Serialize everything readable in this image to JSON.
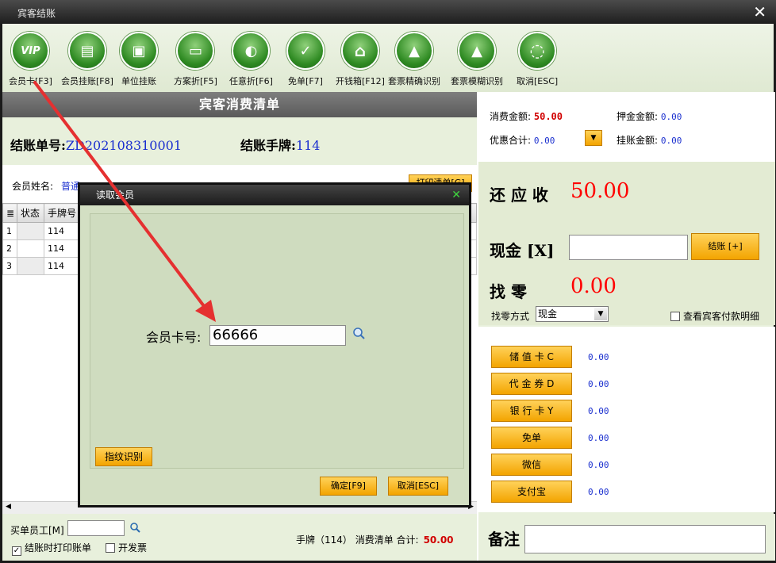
{
  "window": {
    "title": "宾客结账"
  },
  "toolbar": [
    {
      "label": "会员卡[F3]",
      "icon": "vip-icon",
      "glyph": "VIP"
    },
    {
      "label": "会员挂账[F8]",
      "icon": "member-credit-icon",
      "glyph": "▤"
    },
    {
      "label": "单位挂账",
      "icon": "company-credit-icon",
      "glyph": "▣"
    },
    {
      "label": "方案折[F5]",
      "icon": "plan-discount-icon",
      "glyph": "▭"
    },
    {
      "label": "任意折[F6]",
      "icon": "any-discount-icon",
      "glyph": "◐"
    },
    {
      "label": "免单[F7]",
      "icon": "free-bill-icon",
      "glyph": "✓"
    },
    {
      "label": "开钱箱[F12]",
      "icon": "cash-drawer-icon",
      "glyph": "⌂"
    },
    {
      "label": "套票精确识别",
      "icon": "exact-identify-icon",
      "glyph": "▲"
    },
    {
      "label": "套票模糊识别",
      "icon": "fuzzy-identify-icon",
      "glyph": "▲"
    },
    {
      "label": "取消[ESC]",
      "icon": "cancel-icon",
      "glyph": "◌"
    }
  ],
  "bill": {
    "header": "宾客消费清单",
    "number_label": "结账单号:",
    "number": "ZD202108310001",
    "tag_label": "结账手牌:",
    "tag": "114",
    "member_name_label": "会员姓名:",
    "member_name_value": "普通",
    "print_label": "打印清单[G]"
  },
  "table": {
    "columns": [
      "状态",
      "手牌号"
    ],
    "rows": [
      {
        "n": "1",
        "tag": "114"
      },
      {
        "n": "2",
        "tag": "114"
      },
      {
        "n": "3",
        "tag": "114"
      }
    ]
  },
  "footer": {
    "buyer_label": "买单员工[M]",
    "print_on_checkout": "结账时打印账单",
    "issue_invoice": "开发票",
    "summary_prefix": "手牌（114） 消费清单 合计:",
    "summary_total": "50.00"
  },
  "summary": {
    "consume_label": "消费金额:",
    "consume_value": "50.00",
    "deposit_label": "押金金额:",
    "deposit_value": "0.00",
    "discount_label": "优惠合计:",
    "discount_value": "0.00",
    "credit_label": "挂账金额:",
    "credit_value": "0.00"
  },
  "payment": {
    "due_label": "还 应 收",
    "due_value": "50.00",
    "cash_label": "现金 [X]",
    "settle_label": "结账 [+]",
    "change_label": "找    零",
    "change_value": "0.00",
    "change_method_label": "找零方式",
    "change_method_value": "现金",
    "view_detail_label": "查看宾客付款明细"
  },
  "methods": [
    {
      "label": "储 值 卡 C",
      "value": "0.00"
    },
    {
      "label": "代 金 券 D",
      "value": "0.00"
    },
    {
      "label": "银 行 卡 Y",
      "value": "0.00"
    },
    {
      "label": "免单",
      "value": "0.00"
    },
    {
      "label": "微信",
      "value": "0.00"
    },
    {
      "label": "支付宝",
      "value": "0.00"
    }
  ],
  "notes": {
    "label": "备注"
  },
  "dialog": {
    "title": "读取会员",
    "card_label": "会员卡号:",
    "card_value": "66666",
    "fingerprint_label": "指纹识别",
    "ok_label": "确定[F9]",
    "cancel_label": "取消[ESC]"
  },
  "colors": {
    "accent": "#f3a400",
    "money": "#ff0000",
    "link": "#1a2fcf",
    "arrow": "#e53030"
  }
}
